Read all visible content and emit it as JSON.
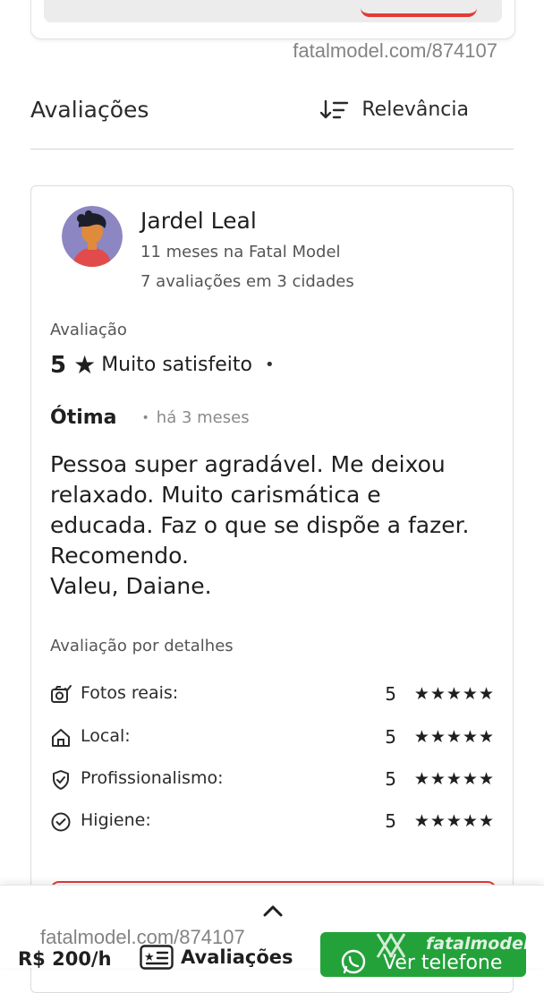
{
  "watermark": "fatalmodel.com/874107",
  "reviews_section": {
    "title": "Avaliações",
    "sort_label": "Relevância",
    "sort_icon": "sort-descending-icon"
  },
  "review": {
    "reviewer_name": "Jardel Leal",
    "member_since": "11 meses na Fatal Model",
    "reviewer_stats": "7 avaliações em 3 cidades",
    "rating_label": "Avaliação",
    "rating_value": "5",
    "rating_text": "Muito satisfeito",
    "headline": "Ótima",
    "time_ago": "há 3 meses",
    "body_lines": [
      "Pessoa super agradável. Me deixou",
      "relaxado. Muito carismática e",
      "educada. Faz o que se dispõe a fazer.",
      "Recomendo.",
      "Valeu, Daiane."
    ],
    "details_label": "Avaliação por detalhes",
    "details": [
      {
        "label": "Fotos reais:",
        "score": "5",
        "stars": "★★★★★",
        "icon": "camera-check-icon"
      },
      {
        "label": "Local:",
        "score": "5",
        "stars": "★★★★★",
        "icon": "home-icon"
      },
      {
        "label": "Profissionalismo:",
        "score": "5",
        "stars": "★★★★★",
        "icon": "shield-check-icon"
      },
      {
        "label": "Higiene:",
        "score": "5",
        "stars": "★★★★★",
        "icon": "check-circle-icon"
      }
    ]
  },
  "bottom_bar": {
    "price": "R$ 200/h",
    "reviews_label": "Avaliações",
    "phone_label": "Ver telefone",
    "brand": "fatalmodel"
  },
  "colors": {
    "accent_red": "#e23b3b",
    "whatsapp_green": "#23a23a",
    "text_dark": "#1f1f1f",
    "text_muted": "#555555"
  }
}
